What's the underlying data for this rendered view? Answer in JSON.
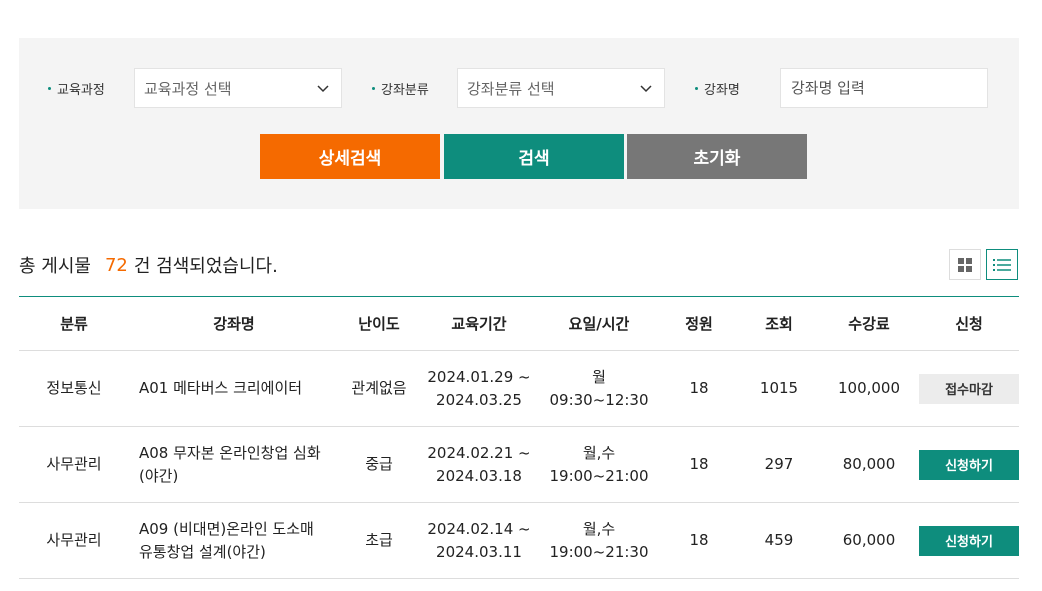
{
  "search": {
    "course_label": "교육과정",
    "course_select": "교육과정 선택",
    "category_label": "강좌분류",
    "category_select": "강좌분류 선택",
    "name_label": "강좌명",
    "name_placeholder": "강좌명 입력",
    "detail_button": "상세검색",
    "search_button": "검색",
    "reset_button": "초기화"
  },
  "summary": {
    "prefix": "총 게시물",
    "count": "72",
    "suffix": "건 검색되었습니다."
  },
  "table": {
    "headers": [
      "분류",
      "강좌명",
      "난이도",
      "교육기간",
      "요일/시간",
      "정원",
      "조회",
      "수강료",
      "신청"
    ],
    "rows": [
      {
        "category": "정보통신",
        "name": "A01 메타버스 크리에이터",
        "level": "관계없음",
        "period_start": "2024.01.29 ~",
        "period_end": "2024.03.25",
        "days": "월 09:30~12:30",
        "time": "",
        "capacity": "18",
        "views": "1015",
        "fee": "100,000",
        "status": "접수마감"
      },
      {
        "category": "사무관리",
        "name": "A08 무자본 온라인창업 심화(야간)",
        "level": "중급",
        "period_start": "2024.02.21 ~",
        "period_end": "2024.03.18",
        "days": "월,수",
        "time": "19:00~21:00",
        "capacity": "18",
        "views": "297",
        "fee": "80,000",
        "status": "신청하기"
      },
      {
        "category": "사무관리",
        "name": "A09 (비대면)온라인 도소매 유통창업 설계(야간)",
        "level": "초급",
        "period_start": "2024.02.14 ~",
        "period_end": "2024.03.11",
        "days": "월,수",
        "time": "19:00~21:30",
        "capacity": "18",
        "views": "459",
        "fee": "60,000",
        "status": "신청하기"
      }
    ]
  },
  "colors": {
    "accent_orange": "#f56a00",
    "accent_teal": "#0e8d7d",
    "reset_gray": "#777777"
  },
  "icons": {
    "grid_view": "grid-view-icon",
    "list_view": "list-view-icon",
    "select_arrow": "chevron-down-icon"
  }
}
